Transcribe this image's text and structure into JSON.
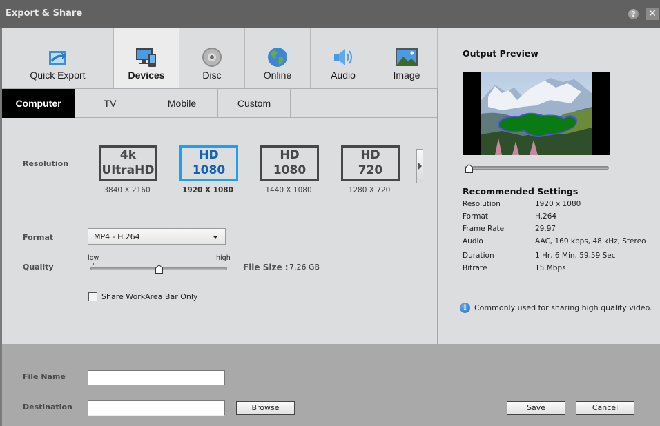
{
  "window": {
    "title": "Export & Share",
    "help_glyph": "?",
    "close_glyph": "✕"
  },
  "categories": [
    {
      "label": "Quick Export",
      "icon": "quick-export-icon",
      "active": false
    },
    {
      "label": "Devices",
      "icon": "devices-icon",
      "active": true
    },
    {
      "label": "Disc",
      "icon": "disc-icon",
      "active": false
    },
    {
      "label": "Online",
      "icon": "globe-icon",
      "active": false
    },
    {
      "label": "Audio",
      "icon": "speaker-icon",
      "active": false
    },
    {
      "label": "Image",
      "icon": "image-icon",
      "active": false
    }
  ],
  "sub_tabs": [
    {
      "label": "Computer",
      "active": true
    },
    {
      "label": "TV",
      "active": false
    },
    {
      "label": "Mobile",
      "active": false
    },
    {
      "label": "Custom",
      "active": false
    }
  ],
  "settings": {
    "resolution_label": "Resolution",
    "resolutions": [
      {
        "line1": "4k",
        "line2": "UltraHD",
        "dims": "3840 X 2160",
        "selected": false
      },
      {
        "line1": "HD",
        "line2": "1080",
        "dims": "1920 X 1080",
        "selected": true
      },
      {
        "line1": "HD",
        "line2": "1080",
        "dims": "1440 X 1080",
        "selected": false
      },
      {
        "line1": "HD",
        "line2": "720",
        "dims": "1280 X 720",
        "selected": false
      }
    ],
    "format_label": "Format",
    "format_value": "MP4 - H.264",
    "quality_label": "Quality",
    "quality_low": "low",
    "quality_high": "high",
    "quality_value_fraction": 0.5,
    "file_size_label": "File Size :",
    "file_size_value": "7.26 GB",
    "share_workarea_label": "Share WorkArea Bar Only",
    "share_workarea_checked": false
  },
  "preview": {
    "title": "Output Preview",
    "scrub_position_fraction": 0.0,
    "recommended_title": "Recommended Settings",
    "recommended": [
      {
        "key": "Resolution",
        "value": "1920 x 1080"
      },
      {
        "key": "Format",
        "value": "H.264"
      },
      {
        "key": "Frame Rate",
        "value": "29.97"
      },
      {
        "key": "Audio",
        "value": "AAC, 160 kbps, 48 kHz, Stereo"
      },
      {
        "key": "Duration",
        "value": "1 Hr, 6 Min, 59.59 Sec"
      },
      {
        "key": "Bitrate",
        "value": "15 Mbps"
      }
    ],
    "info_glyph": "i",
    "info_text": "Commonly used for sharing high quality video."
  },
  "footer": {
    "file_name_label": "File Name",
    "file_name_value": "",
    "destination_label": "Destination",
    "destination_value": "",
    "browse_label": "Browse",
    "save_label": "Save",
    "cancel_label": "Cancel"
  },
  "colors": {
    "accent_selected": "#1ba1f2",
    "selected_text": "#1360b4",
    "titlebar": "#616161",
    "panel": "#dcdddf",
    "footer": "#a9a9a9"
  }
}
